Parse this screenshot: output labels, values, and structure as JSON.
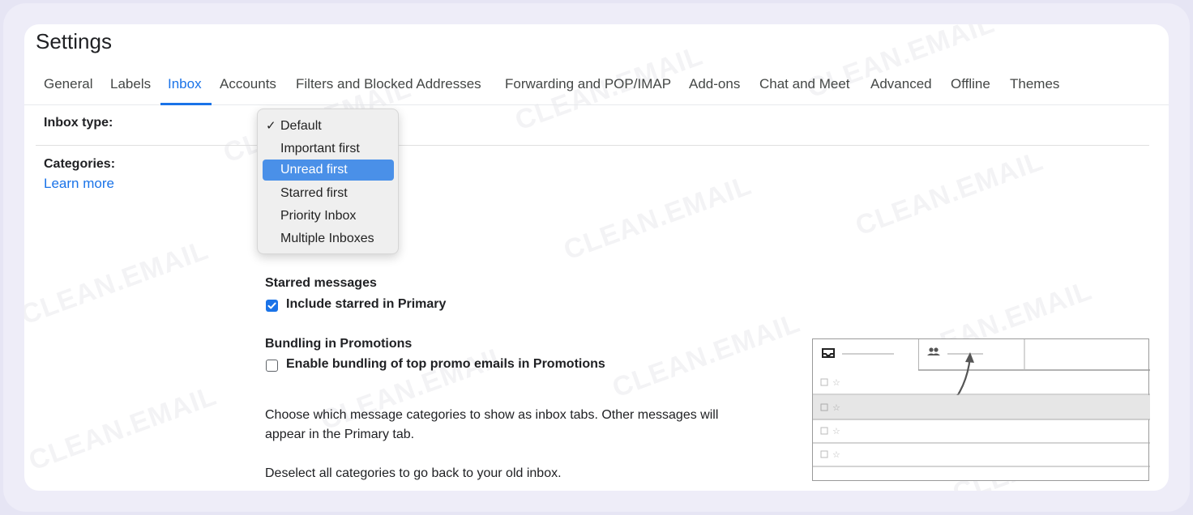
{
  "window": {
    "title": "Settings"
  },
  "tabs": [
    {
      "label": "General"
    },
    {
      "label": "Labels"
    },
    {
      "label": "Inbox"
    },
    {
      "label": "Accounts"
    },
    {
      "label": "Filters and Blocked Addresses"
    },
    {
      "label": "Forwarding and POP/IMAP"
    },
    {
      "label": "Add-ons"
    },
    {
      "label": "Chat and Meet"
    },
    {
      "label": "Advanced"
    },
    {
      "label": "Offline"
    },
    {
      "label": "Themes"
    }
  ],
  "active_tab": "Inbox",
  "inbox_type": {
    "label": "Inbox type:",
    "dropdown": {
      "selected": "Default",
      "highlighted": "Unread first",
      "check_glyph": "✓",
      "options": [
        {
          "label": "Default"
        },
        {
          "label": "Important first"
        },
        {
          "label": "Unread first"
        },
        {
          "label": "Starred first"
        },
        {
          "label": "Priority Inbox"
        },
        {
          "label": "Multiple Inboxes"
        }
      ]
    }
  },
  "categories": {
    "label": "Categories:",
    "learn_more": "Learn more"
  },
  "starred_messages": {
    "heading": "Starred messages",
    "checkbox_label": "Include starred in Primary",
    "checked": true
  },
  "bundling": {
    "heading": "Bundling in Promotions",
    "checkbox_label": "Enable bundling of top promo emails in Promotions",
    "checked": false
  },
  "descriptions": {
    "line1": "Choose which message categories to show as inbox tabs. Other messages will",
    "line2": "appear in the Primary tab.",
    "line3": "Deselect all categories to go back to your old inbox."
  },
  "watermark": {
    "text": "CLEAN.EMAIL"
  },
  "colors": {
    "accent": "#1a73e8",
    "highlight": "#4a90e8",
    "background": "#e6e5f4"
  }
}
